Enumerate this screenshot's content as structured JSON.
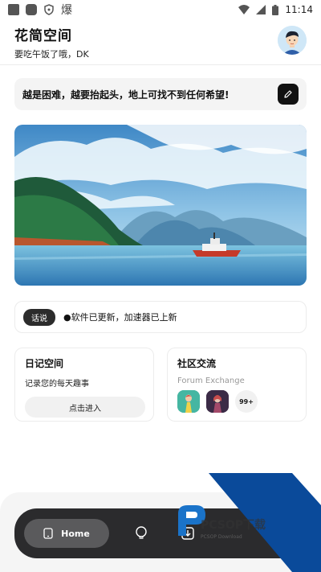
{
  "status_bar": {
    "time": "11:14",
    "fire_glyph": "爆"
  },
  "header": {
    "title": "花简空间",
    "subtitle": "要吃午饭了哦，DK"
  },
  "quote": {
    "text": "越是困难，越要抬起头，地上可找不到任何希望!",
    "edit_icon": "pencil-icon"
  },
  "banner": {
    "description_icon": "landscape-image"
  },
  "notice": {
    "tag": "话说",
    "text": "●软件已更新，加速器已上新"
  },
  "diary_card": {
    "title": "日记空间",
    "desc": "记录您的每天趣事",
    "button": "点击进入"
  },
  "forum_card": {
    "title": "社区交流",
    "subtitle": "Forum Exchange",
    "count": "99+"
  },
  "bottom_nav": {
    "home_label": "Home"
  },
  "watermark": {
    "text": "PCSOP下载",
    "sub": "PCSOP Download"
  },
  "colors": {
    "nav_bg": "#2b2b2d",
    "accent_dark": "#111111",
    "watermark_blue": "#0a4a9a"
  }
}
